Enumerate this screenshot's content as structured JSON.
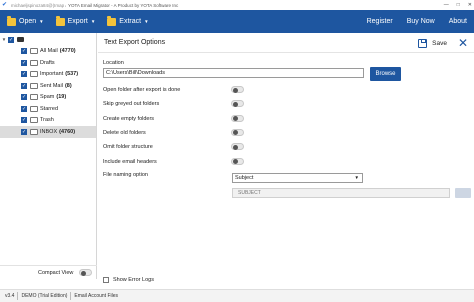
{
  "titlebar": {
    "account": "michaeljspinoza84@(Imap Account)",
    "title": "YOTA Email Migrator - A Product by YOTA Software Inc"
  },
  "toolbar": {
    "open_label": "Open",
    "export_label": "Export",
    "extract_label": "Extract",
    "register_label": "Register",
    "buy_label": "Buy Now",
    "about_label": "About"
  },
  "sidebar": {
    "items": [
      {
        "label": "All Mail",
        "count": "(4770)"
      },
      {
        "label": "Drafts",
        "count": ""
      },
      {
        "label": "Important",
        "count": "(537)"
      },
      {
        "label": "Sent Mail",
        "count": "(8)"
      },
      {
        "label": "Spam",
        "count": "(19)"
      },
      {
        "label": "Starred",
        "count": ""
      },
      {
        "label": "Trash",
        "count": ""
      },
      {
        "label": "INBOX",
        "count": "(4760)"
      }
    ],
    "compact_view_label": "Compact View"
  },
  "options": {
    "title": "Text Export Options",
    "save_label": "Save",
    "location_label": "Location",
    "location_value": "C:\\Users\\Bill\\Downloads",
    "browse_label": "Browse",
    "toggles": [
      {
        "label": "Open folder after export is done",
        "on": false
      },
      {
        "label": "Skip greyed out folders",
        "on": false
      },
      {
        "label": "Create empty folders",
        "on": false
      },
      {
        "label": "Delete old folders",
        "on": false
      },
      {
        "label": "Omit folder structure",
        "on": false
      },
      {
        "label": "Include email headers",
        "on": false
      }
    ],
    "file_naming_label": "File naming option",
    "file_naming_value": "Subject",
    "subject_placeholder": "SUBJECT",
    "show_error_logs_label": "Show Error Logs"
  },
  "statusbar": {
    "version": "v3.4",
    "edition": "DEMO (Trial Edition)",
    "section": "Email Account Files"
  },
  "colors": {
    "accent": "#1e56a0",
    "folder": "#f3c33c"
  },
  "icons": [
    "app-logo-icon",
    "folder-open-icon",
    "export-icon",
    "extract-icon",
    "save-icon",
    "close-icon",
    "checkbox-checked-icon",
    "folder-icon"
  ]
}
